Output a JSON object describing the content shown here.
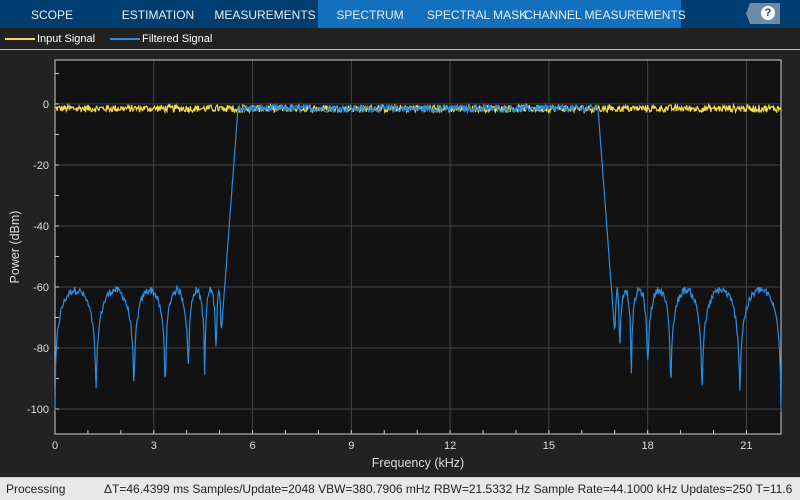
{
  "tabs": [
    "SCOPE",
    "ESTIMATION",
    "MEASUREMENTS",
    "SPECTRUM",
    "SPECTRAL MASK",
    "CHANNEL MEASUREMENTS"
  ],
  "help_label": "?",
  "legend": [
    {
      "label": "Input Signal",
      "color": "#f5d84a"
    },
    {
      "label": "Filtered Signal",
      "color": "#2b8ce0"
    }
  ],
  "status": {
    "state": "Processing",
    "measurements": "ΔT=46.4399 ms  Samples/Update=2048  VBW=380.7906 mHz  RBW=21.5332 Hz  Sample Rate=44.1000 kHz  Updates=250  T=11.6"
  },
  "chart_data": {
    "type": "line",
    "xlabel": "Frequency (kHz)",
    "ylabel": "Power (dBm)",
    "xlim": [
      0,
      22.05
    ],
    "ylim": [
      -108.2,
      14.4
    ],
    "xticks": [
      0,
      3,
      6,
      9,
      12,
      15,
      18,
      21
    ],
    "yticks": [
      0,
      -20,
      -40,
      -60,
      -80,
      -100
    ],
    "grid": true,
    "legend_position": "top-left",
    "series": [
      {
        "name": "Input Signal",
        "color": "#f5d84a",
        "level_dbm": -1.5,
        "noise_db": 1.2
      },
      {
        "name": "Filtered Signal",
        "color": "#2b8ce0",
        "passband_khz": [
          5.55,
          16.5
        ],
        "passband_level_dbm": -1.5,
        "stopband_peak_dbm": -61,
        "null_freqs_khz": [
          1.25,
          2.4,
          3.35,
          4.05,
          4.55,
          4.9,
          5.05
        ],
        "null_depths_dbm": [
          -94,
          -92,
          -90,
          -85,
          -91,
          -79,
          -75
        ]
      }
    ]
  }
}
